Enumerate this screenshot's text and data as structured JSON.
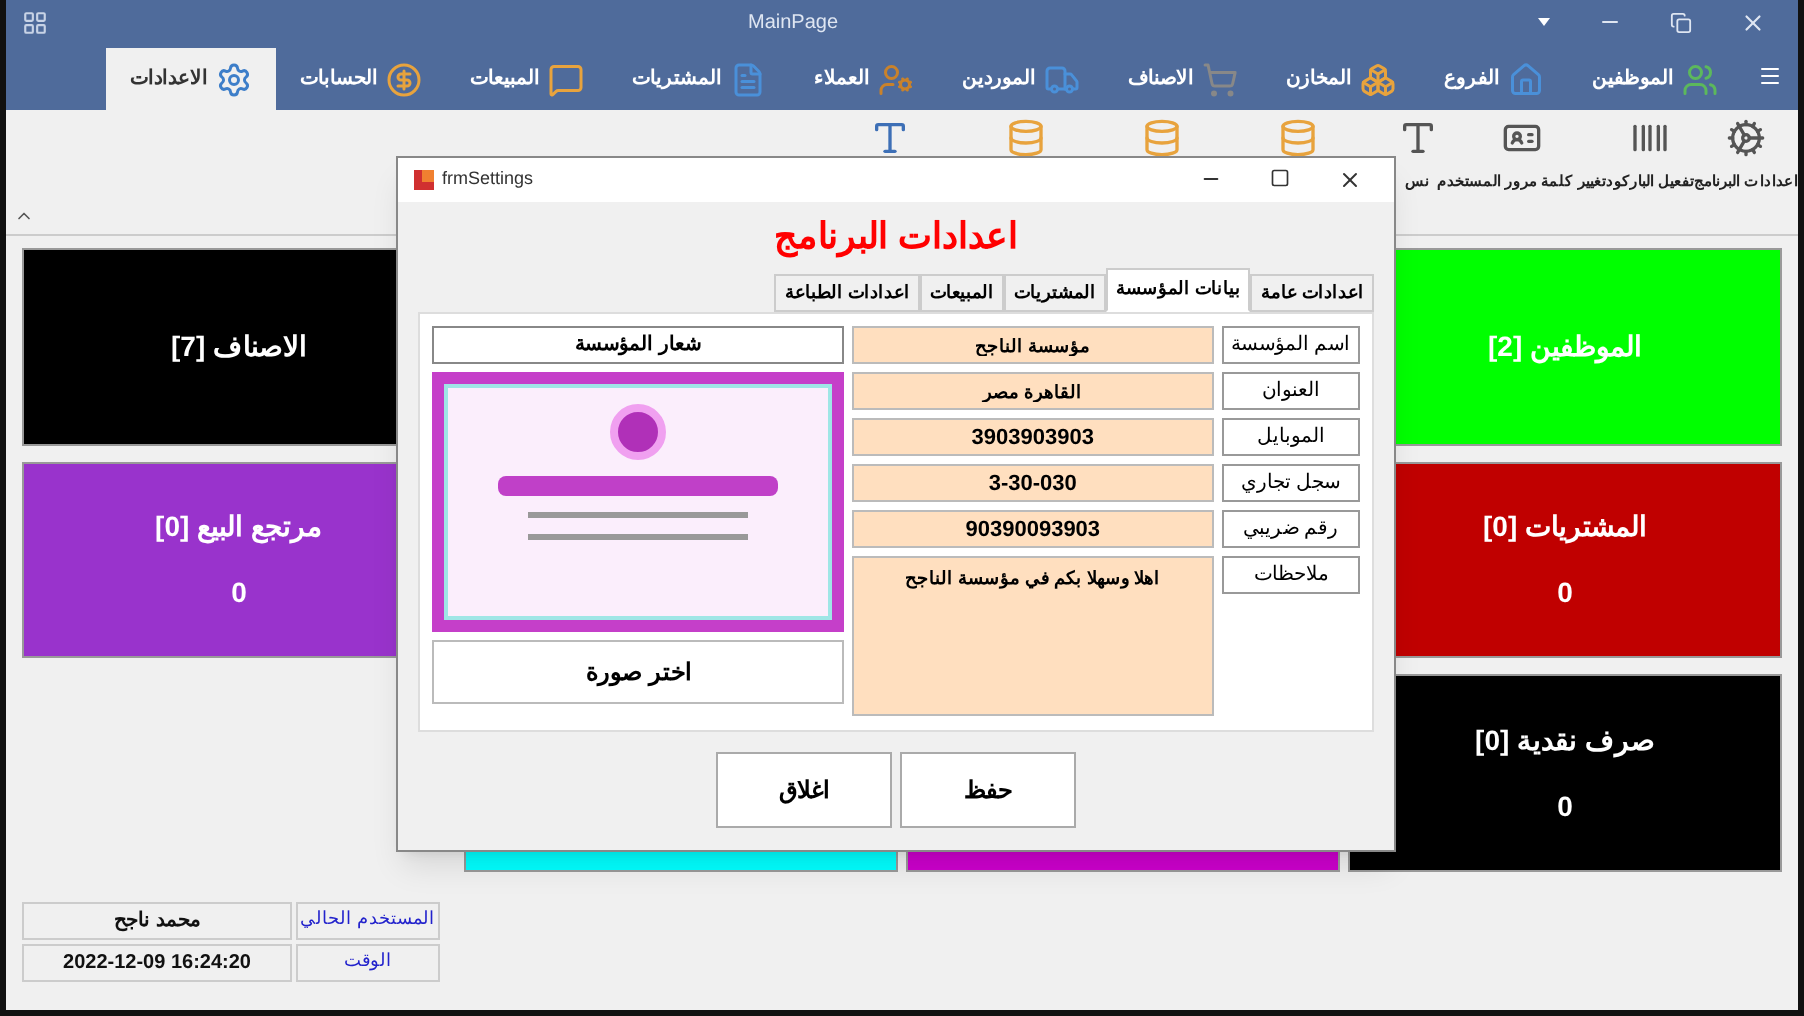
{
  "main_window": {
    "title": "MainPage"
  },
  "ribbon_tabs": [
    {
      "label": "الموظفين",
      "selected": false
    },
    {
      "label": "الفروع",
      "selected": false
    },
    {
      "label": "المخازن",
      "selected": false
    },
    {
      "label": "الاصناف",
      "selected": false
    },
    {
      "label": "الموردين",
      "selected": false
    },
    {
      "label": "العملاء",
      "selected": false
    },
    {
      "label": "المشتريات",
      "selected": false
    },
    {
      "label": "المبيعات",
      "selected": false
    },
    {
      "label": "الحسابات",
      "selected": false
    },
    {
      "label": "الاعدادات",
      "selected": true
    }
  ],
  "ribbon_buttons": [
    {
      "label": "اعدادات البرنامج"
    },
    {
      "label": "تفعيل الباركود"
    },
    {
      "label": "تغيير كلمة مرور المستخدم"
    },
    {
      "label": "نس"
    }
  ],
  "tiles": [
    {
      "title": "الموظفين [2]",
      "color": "#00ff00"
    },
    {
      "title": "الاصناف [7]",
      "color": "#000000"
    },
    {
      "title": "المشتريات [0]",
      "value": "0",
      "color": "#c00000"
    },
    {
      "title": "مرتجع البيع [0]",
      "value": "0",
      "color": "#9933cc"
    },
    {
      "title": "صرف نقدية [0]",
      "value": "0",
      "color": "#000000"
    },
    {
      "color": "#cc00cc"
    },
    {
      "color": "#00ffff"
    }
  ],
  "status": [
    {
      "label": "المستخدم الحالي",
      "value": "محمد ناجح"
    },
    {
      "label": "الوقت",
      "value": "2022-12-09 16:24:20"
    }
  ],
  "dialog": {
    "title": "frmSettings",
    "heading": "اعدادات البرنامج",
    "tabs": [
      {
        "label": "اعدادات عامة",
        "selected": false
      },
      {
        "label": "بيانات المؤسسة",
        "selected": true
      },
      {
        "label": "المشتريات",
        "selected": false
      },
      {
        "label": "المبيعات",
        "selected": false
      },
      {
        "label": "اعدادات الطباعة",
        "selected": false
      }
    ],
    "fields": [
      {
        "label": "اسم المؤسسة",
        "value": "مؤسسة الناجح",
        "kind": "text"
      },
      {
        "label": "العنوان",
        "value": "القاهرة مصر",
        "kind": "text"
      },
      {
        "label": "الموبايل",
        "value": "3903903903",
        "kind": "text"
      },
      {
        "label": "سجل تجاري",
        "value": "3-30-030",
        "kind": "text"
      },
      {
        "label": "رقم ضريبي",
        "value": "90390093903",
        "kind": "text"
      },
      {
        "label": "ملاحظات",
        "value": "اهلا وسهلا بكم في مؤسسة الناجح",
        "kind": "multiline"
      }
    ],
    "logo_label": "شعار المؤسسة",
    "choose_image_button": "اختر صورة",
    "buttons": [
      "حفظ",
      "اغلاق"
    ]
  }
}
